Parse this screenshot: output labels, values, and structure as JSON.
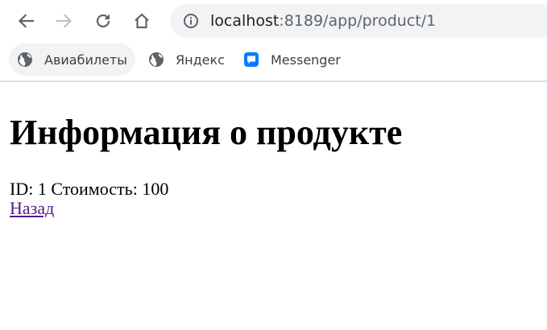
{
  "browser": {
    "address_bar": {
      "host": "localhost",
      "path": ":8189/app/product/1"
    },
    "icons": {
      "back": "arrow-left-icon",
      "forward": "arrow-right-icon",
      "reload": "reload-icon",
      "home": "home-icon",
      "info": "info-icon"
    },
    "bookmarks": [
      {
        "label": "Авиабилеты",
        "icon": "globe-icon"
      },
      {
        "label": "Яндекс",
        "icon": "globe-icon"
      },
      {
        "label": "Messenger",
        "icon": "messenger-icon"
      }
    ]
  },
  "page": {
    "title": "Информация о продукте",
    "id_label": "ID:",
    "id_value": "1",
    "price_label": "Стоимость:",
    "price_value": "100",
    "back_link": "Назад"
  },
  "colors": {
    "link_visited": "#551a8b",
    "messenger": "#0a7cff",
    "omnibox_bg": "#f1f3f4"
  }
}
